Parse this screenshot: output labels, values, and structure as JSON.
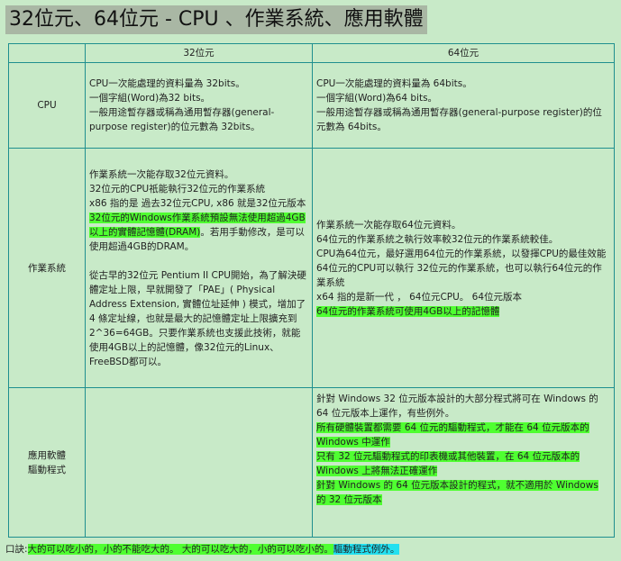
{
  "title": "32位元、64位元 - CPU 、作業系統、應用軟體",
  "table": {
    "headers": [
      "",
      "32位元",
      "64位元"
    ],
    "rows": [
      {
        "label": "CPU",
        "col32": [
          {
            "text": "CPU一次能處理的資料量為 32bits。",
            "hl": ""
          },
          {
            "text": "一個字組(Word)為32 bits。",
            "hl": ""
          },
          {
            "text": "一般用途暫存器或稱為通用暫存器(general-purpose register)的位元數為 32bits。",
            "hl": ""
          }
        ],
        "col64": [
          {
            "text": "CPU一次能處理的資料量為 64bits。",
            "hl": ""
          },
          {
            "text": "一個字組(Word)為64 bits。",
            "hl": ""
          },
          {
            "text": "一般用途暫存器或稱為通用暫存器(general-purpose register)的位元數為 64bits。",
            "hl": ""
          }
        ]
      },
      {
        "label": "作業系統",
        "col32_p1": [
          {
            "text": "作業系統一次能存取32位元資料。",
            "hl": ""
          },
          {
            "text": "32位元的CPU祇能執行32位元的作業系統",
            "hl": ""
          },
          {
            "text": "x86 指的是 過去32位元CPU, x86 就是32位元版本",
            "hl": ""
          }
        ],
        "col32_p2_hl": "32位元的Windows作業系統預設無法使用超過4GB以上的實體記憶體(DRAM)",
        "col32_p2_rest": "。若用手動修改，是可以使用超過4GB的DRAM。",
        "col32_p3": "從古早的32位元 Pentium II CPU開始，為了解決硬體定址上限，早就開發了「PAE」( Physical Address Extension, 實體位址延伸 ) 模式，增加了 4 條定址線，也就是最大的記憶體定址上限擴充到 2^36=64GB。只要作業系統也支援此技術，就能使用4GB以上的記憶體，像32位元的Linux、FreeBSD都可以。",
        "col64": [
          {
            "text": "作業系統一次能存取64位元資料。",
            "hl": ""
          },
          {
            "text": "64位元的作業系統之執行效率較32位元的作業系統較佳。",
            "hl": ""
          },
          {
            "text": "CPU為64位元，最好選用64位元的作業系統，以發揮CPU的最佳效能",
            "hl": ""
          },
          {
            "text": "64位元的CPU可以執行 32位元的作業系統，也可以執行64位元的作業系統",
            "hl": ""
          },
          {
            "text": "x64 指的是新一代 ， 64位元CPU。 64位元版本",
            "hl": ""
          },
          {
            "text": "64位元的作業系統可使用4GB以上的記憶體",
            "hl": "green"
          }
        ]
      },
      {
        "label_line1": "應用軟體",
        "label_line2": "驅動程式",
        "col32": "",
        "col64": [
          {
            "text": "針對 Windows 32 位元版本設計的大部分程式將可在 Windows 的 64 位元版本上運作，有些例外。",
            "hl": ""
          },
          {
            "text": "所有硬體裝置都需要 64 位元的驅動程式，才能在 64 位元版本的 Windows 中運作",
            "hl": "green"
          },
          {
            "text": "只有 32 位元驅動程式的印表機或其他裝置，在 64 位元版本的 Windows 上將無法正確運作",
            "hl": "green"
          },
          {
            "text": "針對 Windows 的 64 位元版本設計的程式，就不適用於 Windows 的 32 位元版本",
            "hl": "green"
          }
        ]
      }
    ]
  },
  "footer": {
    "prefix": "口訣:",
    "seg1": "大的可以吃小的，小的不能吃大的。",
    "seg2": " 大的可以吃大的，小的可以吃小的。",
    "seg3": "驅動程式例外。"
  }
}
